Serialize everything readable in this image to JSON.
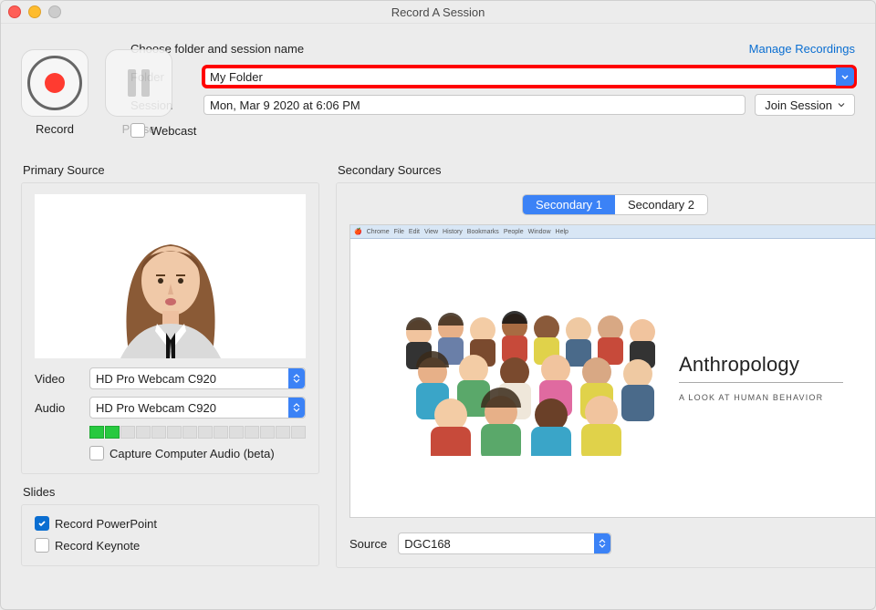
{
  "window": {
    "title": "Record A Session"
  },
  "controls": {
    "record_label": "Record",
    "pause_label": "Pause"
  },
  "form": {
    "heading": "Choose folder and session name",
    "manage_link": "Manage Recordings",
    "folder_label": "Folder",
    "folder_value": "My Folder",
    "session_label": "Session",
    "session_value": "Mon, Mar 9 2020 at 6:06 PM",
    "join_label": "Join Session",
    "webcast_label": "Webcast"
  },
  "primary": {
    "title": "Primary Source",
    "video_label": "Video",
    "video_value": "HD Pro Webcam C920",
    "audio_label": "Audio",
    "audio_value": "HD Pro Webcam C920",
    "capture_audio_label": "Capture Computer Audio (beta)"
  },
  "slides": {
    "title": "Slides",
    "record_ppt": "Record PowerPoint",
    "record_keynote": "Record Keynote"
  },
  "secondary": {
    "title": "Secondary Sources",
    "tab1": "Secondary 1",
    "tab2": "Secondary 2",
    "slide_title": "Anthropology",
    "slide_sub": "A LOOK AT HUMAN BEHAVIOR",
    "source_label": "Source",
    "source_value": "DGC168"
  }
}
